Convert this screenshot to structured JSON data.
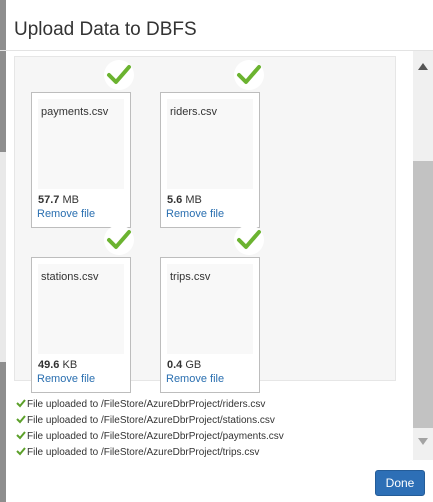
{
  "dialog": {
    "title": "Upload Data to DBFS"
  },
  "files": [
    {
      "name": "payments.csv",
      "size_value": "57.7",
      "size_unit": "MB",
      "remove_label": "Remove file"
    },
    {
      "name": "riders.csv",
      "size_value": "5.6",
      "size_unit": "MB",
      "remove_label": "Remove file"
    },
    {
      "name": "stations.csv",
      "size_value": "49.6",
      "size_unit": "KB",
      "remove_label": "Remove file"
    },
    {
      "name": "trips.csv",
      "size_value": "0.4",
      "size_unit": "GB",
      "remove_label": "Remove file"
    }
  ],
  "log": [
    "File uploaded to /FileStore/AzureDbrProject/riders.csv",
    "File uploaded to /FileStore/AzureDbrProject/stations.csv",
    "File uploaded to /FileStore/AzureDbrProject/payments.csv",
    "File uploaded to /FileStore/AzureDbrProject/trips.csv"
  ],
  "footer": {
    "done_label": "Done"
  },
  "colors": {
    "accent": "#2d6fb6",
    "success": "#6bb330",
    "link": "#2a6fb0"
  },
  "icons": {
    "upload_complete": "checkmark-icon",
    "log_success": "checkmark-icon"
  }
}
